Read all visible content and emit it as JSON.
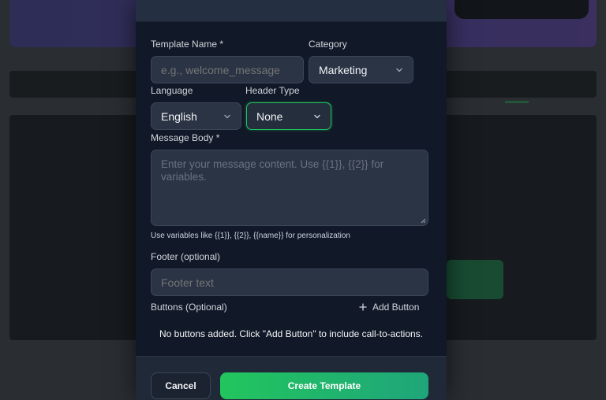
{
  "form": {
    "template_name": {
      "label": "Template Name *",
      "placeholder": "e.g., welcome_message"
    },
    "category": {
      "label": "Category",
      "value": "Marketing"
    },
    "language": {
      "label": "Language",
      "value": "English"
    },
    "header_type": {
      "label": "Header Type",
      "value": "None"
    },
    "message_body": {
      "label": "Message Body *",
      "placeholder": "Enter your message content. Use {{1}}, {{2}} for variables.",
      "hint": "Use variables like {{1}}, {{2}}, {{name}} for personalization"
    },
    "footer": {
      "label": "Footer (optional)",
      "placeholder": "Footer text"
    },
    "buttons": {
      "label": "Buttons (Optional)",
      "add_label": "Add Button",
      "empty_text": "No buttons added. Click \"Add Button\" to include call-to-actions."
    }
  },
  "footer_actions": {
    "cancel_label": "Cancel",
    "create_label": "Create Template"
  },
  "colors": {
    "accent": "#22c55e",
    "modal_bg": "#111827",
    "field_bg": "#2a3444"
  },
  "icons": {
    "select_chevron": "chevron-down-icon",
    "add": "plus-icon"
  }
}
